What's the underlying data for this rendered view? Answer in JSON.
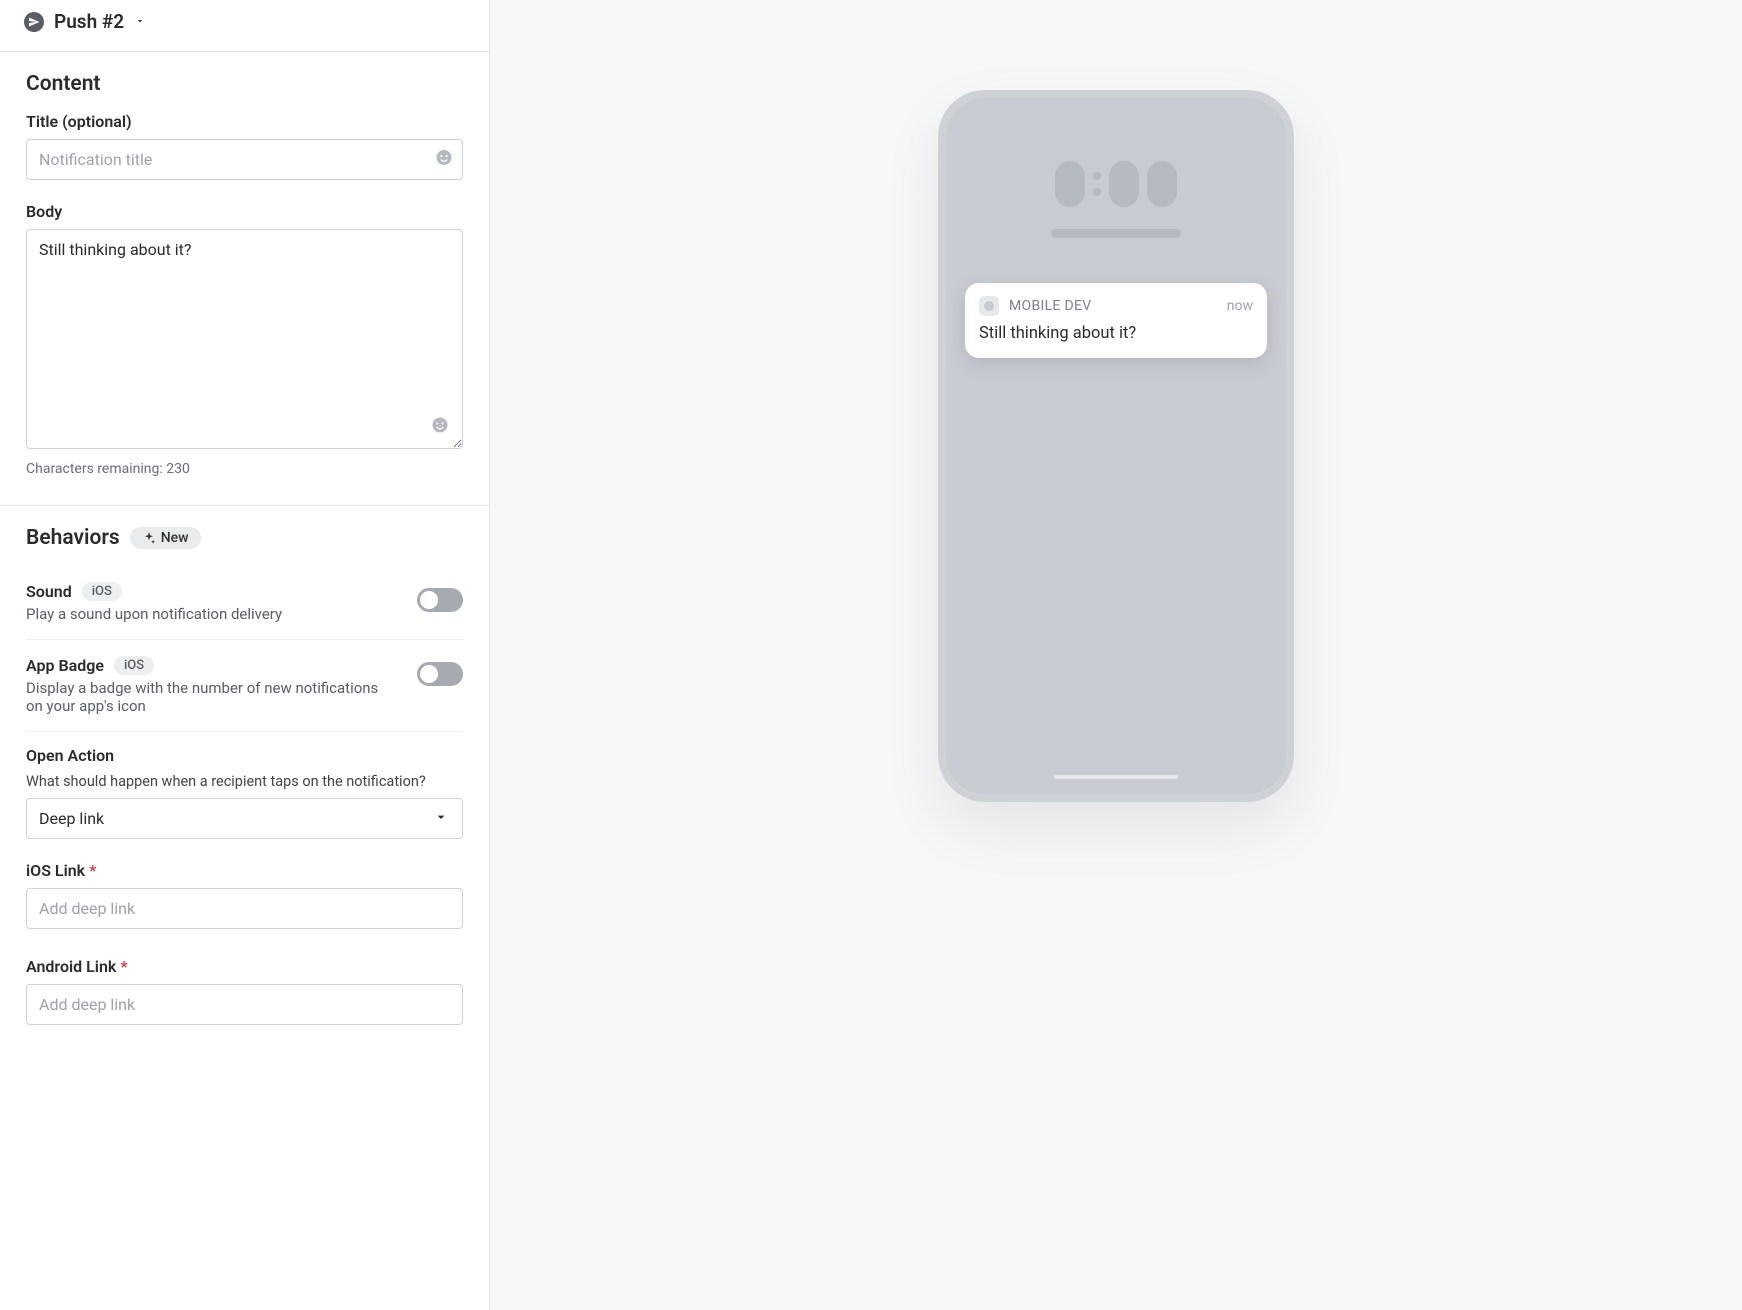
{
  "header": {
    "push_title": "Push #2"
  },
  "content": {
    "section_title": "Content",
    "title_label": "Title (optional)",
    "title_placeholder": "Notification title",
    "title_value": "",
    "body_label": "Body",
    "body_value": "Still thinking about it?",
    "chars_remaining_prefix": "Characters remaining: ",
    "chars_remaining_value": "230"
  },
  "behaviors": {
    "section_title": "Behaviors",
    "new_badge": "New",
    "sound": {
      "title": "Sound",
      "platform_chip": "iOS",
      "desc": "Play a sound upon notification delivery"
    },
    "app_badge": {
      "title": "App Badge",
      "platform_chip": "iOS",
      "desc": "Display a badge with the number of new notifications on your app's icon"
    },
    "open_action": {
      "title": "Open Action",
      "desc": "What should happen when a recipient taps on the notification?",
      "selected": "Deep link"
    },
    "ios_link": {
      "title": "iOS Link",
      "placeholder": "Add deep link",
      "value": ""
    },
    "android_link": {
      "title": "Android Link",
      "placeholder": "Add deep link",
      "value": ""
    }
  },
  "preview": {
    "app_name": "MOBILE DEV",
    "time": "now",
    "body": "Still thinking about it?"
  }
}
